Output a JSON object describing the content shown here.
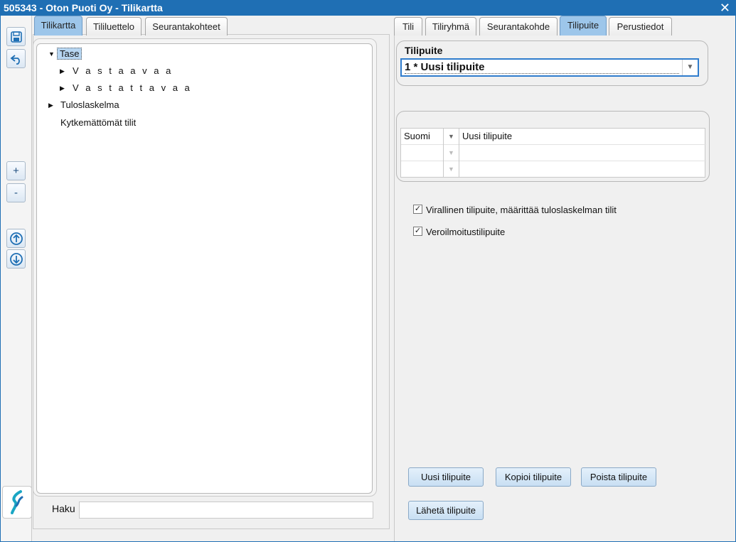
{
  "window": {
    "title": "505343 - Oton Puoti Oy - Tilikartta",
    "close_glyph": "✕"
  },
  "toolbar": {
    "save_icon": "save-icon",
    "undo_icon": "undo-icon",
    "expand_label": "+",
    "collapse_label": "-",
    "up_icon": "arrow-up-icon",
    "down_icon": "arrow-down-icon",
    "logo_icon": "app-logo-icon"
  },
  "left_tabs": [
    {
      "label": "Tilikartta",
      "active": true
    },
    {
      "label": "Tililuettelo",
      "active": false
    },
    {
      "label": "Seurantakohteet",
      "active": false
    }
  ],
  "tree": {
    "items": [
      {
        "label": "Tase",
        "expanded": true,
        "selected": true
      },
      {
        "label": "V a s t a a v a a",
        "expanded": false
      },
      {
        "label": "V a s t a t t a v a a",
        "expanded": false
      },
      {
        "label": "Tuloslaskelma",
        "expanded": false
      },
      {
        "label": "Kytkemättömät tilit"
      }
    ]
  },
  "search": {
    "label": "Haku",
    "value": ""
  },
  "right_tabs": [
    {
      "label": "Tili",
      "active": false
    },
    {
      "label": "Tiliryhmä",
      "active": false
    },
    {
      "label": "Seurantakohde",
      "active": false
    },
    {
      "label": "Tilipuite",
      "active": true
    },
    {
      "label": "Perustiedot",
      "active": false
    }
  ],
  "tilipuite": {
    "group_title": "Tilipuite",
    "selected_value": "1 * Uusi tilipuite"
  },
  "names_grid": {
    "rows": [
      {
        "language": "Suomi",
        "name": "Uusi tilipuite"
      },
      {
        "language": "",
        "name": ""
      },
      {
        "language": "",
        "name": ""
      }
    ]
  },
  "checkboxes": [
    {
      "label": "Virallinen tilipuite, määrittää tuloslaskelman tilit",
      "checked": true
    },
    {
      "label": "Veroilmoitustilipuite",
      "checked": true
    }
  ],
  "buttons": {
    "new": "Uusi tilipuite",
    "copy": "Kopioi tilipuite",
    "delete": "Poista tilipuite",
    "send": "Lähetä tilipuite"
  },
  "colors": {
    "titlebar": "#1f6fb4",
    "active_tab": "#9dc6ea",
    "focus_border": "#2f7ccd"
  }
}
